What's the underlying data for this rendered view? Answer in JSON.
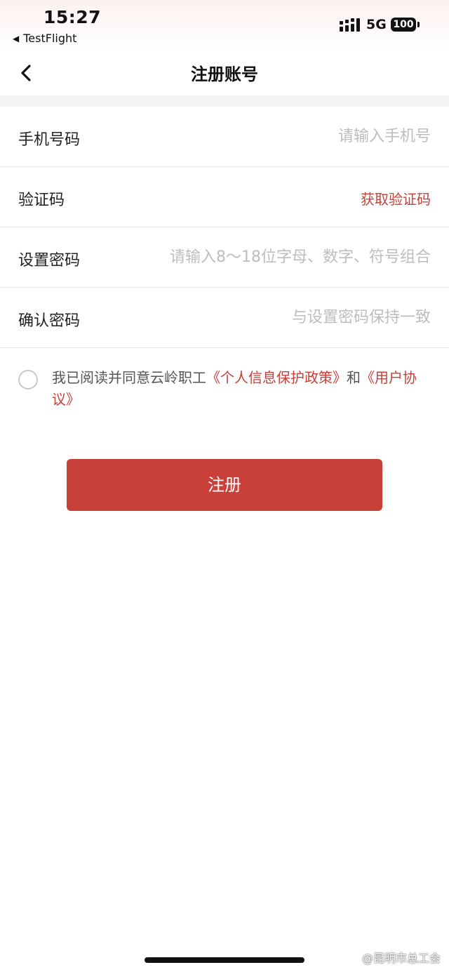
{
  "status_bar": {
    "time": "15:27",
    "back_app": "TestFlight",
    "network": "5G",
    "battery": "100"
  },
  "nav": {
    "title": "注册账号"
  },
  "form": {
    "phone": {
      "label": "手机号码",
      "placeholder": "请输入手机号"
    },
    "code": {
      "label": "验证码",
      "action": "获取验证码"
    },
    "password": {
      "label": "设置密码",
      "placeholder": "请输入8～18位字母、数字、符号组合"
    },
    "confirm": {
      "label": "确认密码",
      "placeholder": "与设置密码保持一致"
    }
  },
  "agreement": {
    "prefix": "我已阅读并同意云岭职工",
    "privacy_link": "《个人信息保护政策》",
    "and": "和",
    "user_link": "《用户协议》"
  },
  "submit_label": "注册",
  "watermark": "@昆明市总工会",
  "colors": {
    "accent": "#c9403a",
    "placeholder": "#bdbdbd",
    "divider": "#e8e8e8"
  },
  "icons": {
    "back": "chevron-left-icon",
    "signal": "signal-icon",
    "battery": "battery-icon"
  }
}
